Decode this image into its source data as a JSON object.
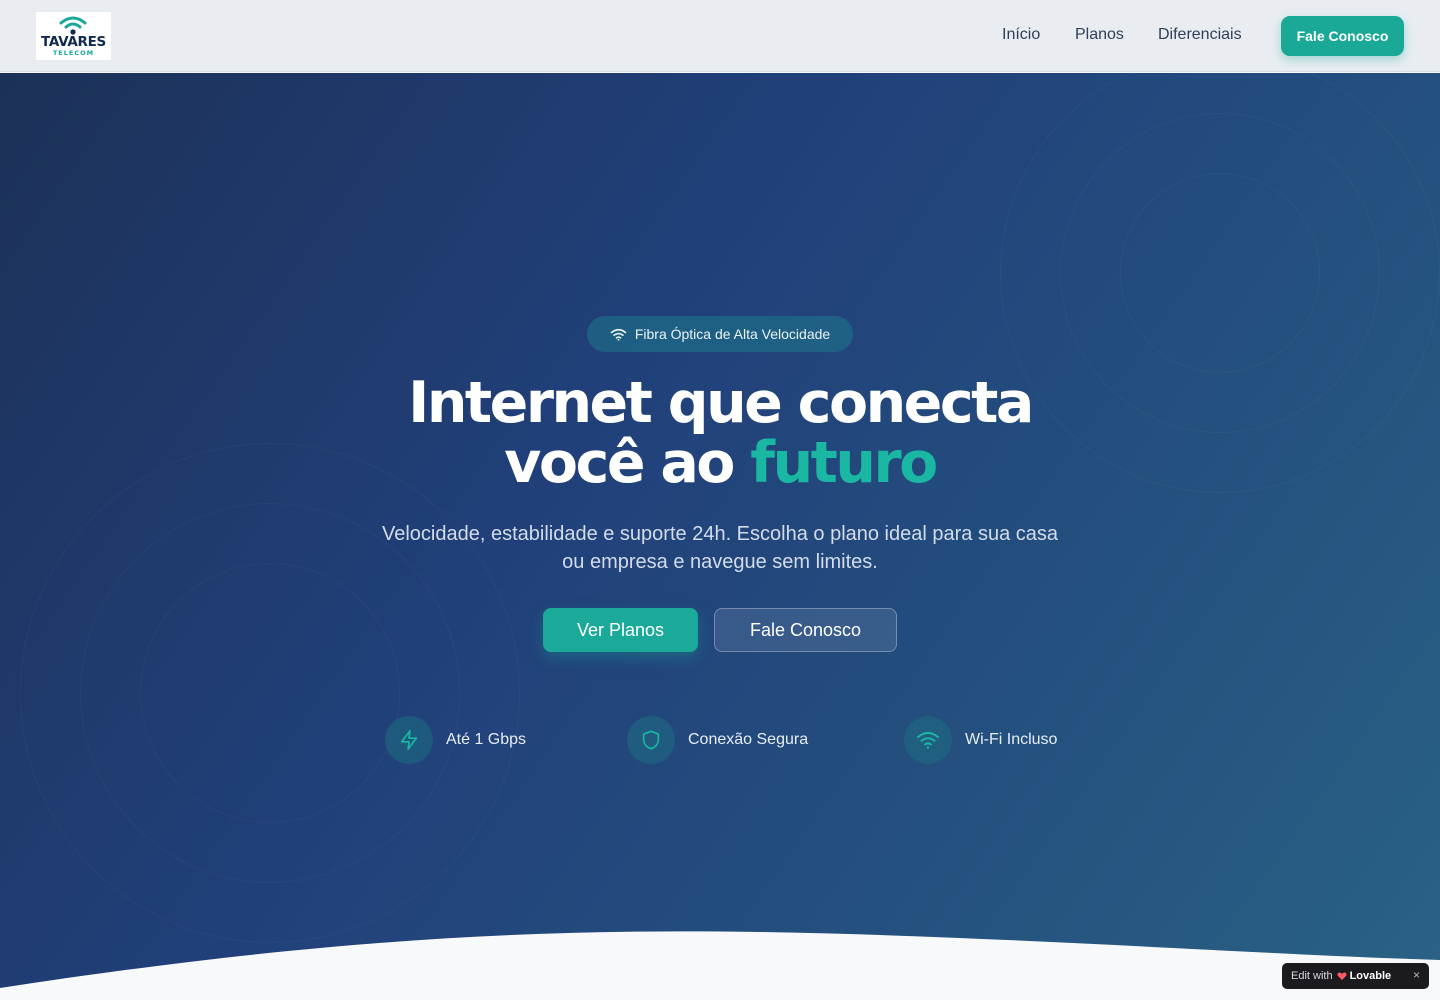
{
  "colors": {
    "accent": "#1ab8a3",
    "primary_button": "#1ba99a",
    "hero_dark": "#1c3158",
    "nav_bg": "#e9edf2"
  },
  "logo": {
    "main": "TAVARES",
    "sub": "TELECOM",
    "icon": "wifi-icon"
  },
  "nav": {
    "links": [
      "Início",
      "Planos",
      "Diferenciais"
    ],
    "cta": "Fale Conosco"
  },
  "hero": {
    "badge": {
      "icon": "wifi-icon",
      "text": "Fibra Óptica de Alta Velocidade"
    },
    "headline_line1": "Internet que conecta",
    "headline_line2_plain": "você ao ",
    "headline_line2_accent": "futuro",
    "subtitle": "Velocidade, estabilidade e suporte 24h. Escolha o plano ideal para sua casa ou empresa e navegue sem limites.",
    "primary_button": "Ver Planos",
    "secondary_button": "Fale Conosco",
    "features": [
      {
        "icon": "lightning-icon",
        "label": "Até 1 Gbps"
      },
      {
        "icon": "shield-icon",
        "label": "Conexão Segura"
      },
      {
        "icon": "wifi-icon",
        "label": "Wi-Fi Incluso"
      }
    ]
  },
  "lovable_badge": {
    "prefix": "Edit with",
    "brand": "Lovable",
    "close": "×"
  }
}
